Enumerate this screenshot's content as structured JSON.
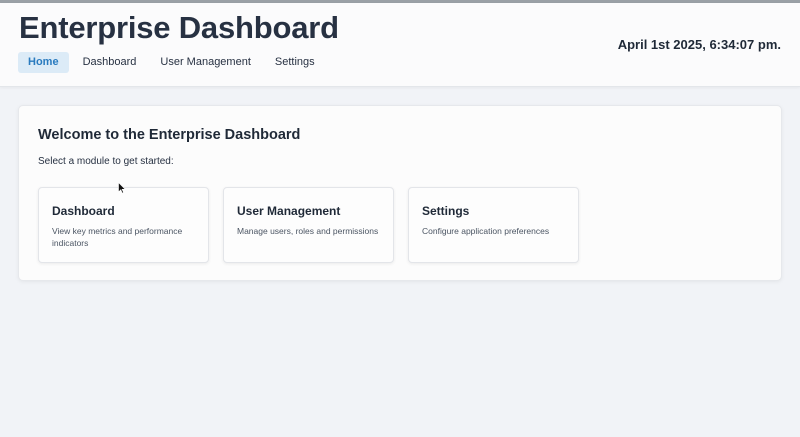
{
  "header": {
    "title": "Enterprise Dashboard",
    "datetime": "April 1st 2025, 6:34:07 pm."
  },
  "nav": {
    "items": [
      {
        "label": "Home",
        "active": true
      },
      {
        "label": "Dashboard",
        "active": false
      },
      {
        "label": "User Management",
        "active": false
      },
      {
        "label": "Settings",
        "active": false
      }
    ]
  },
  "welcome": {
    "title": "Welcome to the Enterprise Dashboard",
    "subtitle": "Select a module to get started:"
  },
  "modules": [
    {
      "title": "Dashboard",
      "description": "View key metrics and performance indicators"
    },
    {
      "title": "User Management",
      "description": "Manage users, roles and permissions"
    },
    {
      "title": "Settings",
      "description": "Configure application preferences"
    }
  ],
  "colors": {
    "accent": "#2a7bbf",
    "accent_bg": "#dcebf7",
    "page_bg": "#f1f3f7",
    "title": "#273142"
  },
  "icons": {
    "cursor": "mouse-pointer-icon"
  }
}
